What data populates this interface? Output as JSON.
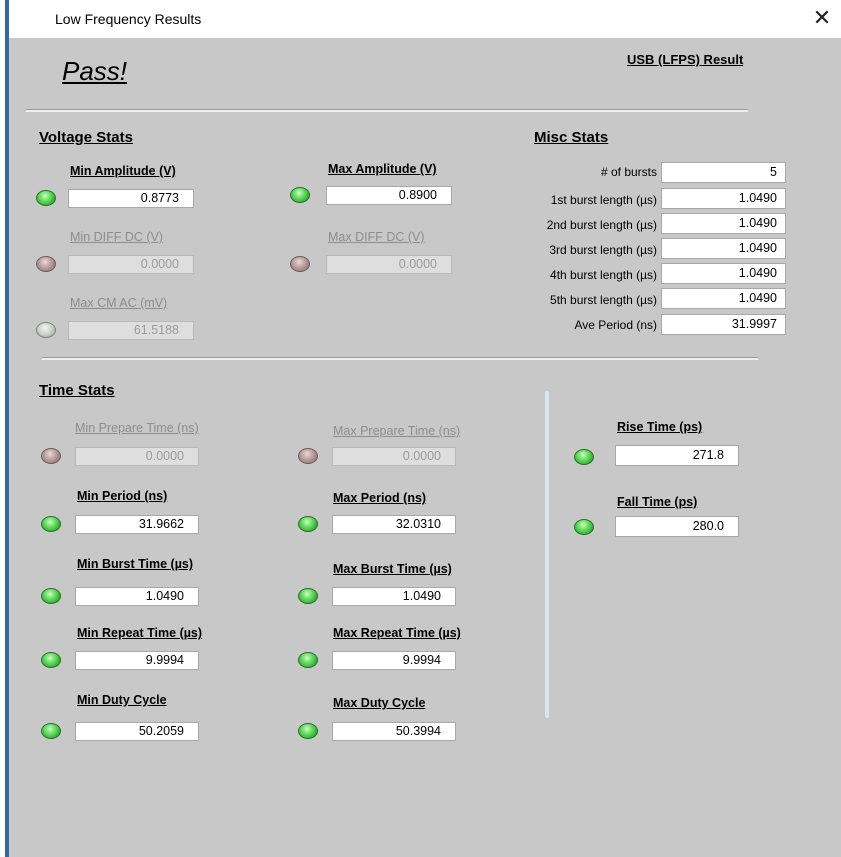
{
  "window": {
    "title": "Low Frequency Results",
    "close_glyph": "✕"
  },
  "header": {
    "status": "Pass!",
    "mode_label": "USB (LFPS) Result"
  },
  "voltage_stats": {
    "title": "Voltage Stats",
    "min_amplitude": {
      "label": "Min Amplitude (V)",
      "value": "0.8773",
      "led": "green"
    },
    "max_amplitude": {
      "label": "Max Amplitude (V)",
      "value": "0.8900",
      "led": "green"
    },
    "min_diff_dc": {
      "label": "Min DIFF DC (V)",
      "value": "0.0000",
      "led": "brown"
    },
    "max_diff_dc": {
      "label": "Max DIFF DC (V)",
      "value": "0.0000",
      "led": "brown"
    },
    "max_cm_ac": {
      "label": "Max CM AC (mV)",
      "value": "61.5188",
      "led": "gray"
    }
  },
  "misc_stats": {
    "title": "Misc Stats",
    "rows": [
      {
        "label": "# of bursts",
        "value": "5"
      },
      {
        "label": "1st burst length (µs)",
        "value": "1.0490"
      },
      {
        "label": "2nd burst length (µs)",
        "value": "1.0490"
      },
      {
        "label": "3rd burst length (µs)",
        "value": "1.0490"
      },
      {
        "label": "4th burst length (µs)",
        "value": "1.0490"
      },
      {
        "label": "5th burst length (µs)",
        "value": "1.0490"
      },
      {
        "label": "Ave Period (ns)",
        "value": "31.9997"
      }
    ]
  },
  "time_stats": {
    "title": "Time Stats",
    "min_prepare_time": {
      "label": "Min Prepare Time (ns)",
      "value": "0.0000",
      "led": "brown"
    },
    "max_prepare_time": {
      "label": "Max Prepare Time (ns)",
      "value": "0.0000",
      "led": "brown"
    },
    "min_period": {
      "label": "Min Period (ns)",
      "value": "31.9662",
      "led": "green"
    },
    "max_period": {
      "label": "Max Period (ns)",
      "value": "32.0310",
      "led": "green"
    },
    "min_burst_time": {
      "label": "Min Burst Time (µs)",
      "value": "1.0490",
      "led": "green"
    },
    "max_burst_time": {
      "label": "Max Burst Time (µs)",
      "value": "1.0490",
      "led": "green"
    },
    "min_repeat_time": {
      "label": "Min Repeat Time (µs)",
      "value": "9.9994",
      "led": "green"
    },
    "max_repeat_time": {
      "label": "Max Repeat Time (µs)",
      "value": "9.9994",
      "led": "green"
    },
    "min_duty_cycle": {
      "label": "Min Duty Cycle",
      "value": "50.2059",
      "led": "green"
    },
    "max_duty_cycle": {
      "label": "Max Duty Cycle",
      "value": "50.3994",
      "led": "green"
    },
    "rise_time": {
      "label": "Rise Time (ps)",
      "value": "271.8",
      "led": "green"
    },
    "fall_time": {
      "label": "Fall Time (ps)",
      "value": "280.0",
      "led": "green"
    }
  },
  "colors": {
    "panel_bg": "#c8c8c8",
    "led_green": "#3fbf3f",
    "led_brown": "#a88c8c",
    "led_gray": "#c2cac0"
  }
}
